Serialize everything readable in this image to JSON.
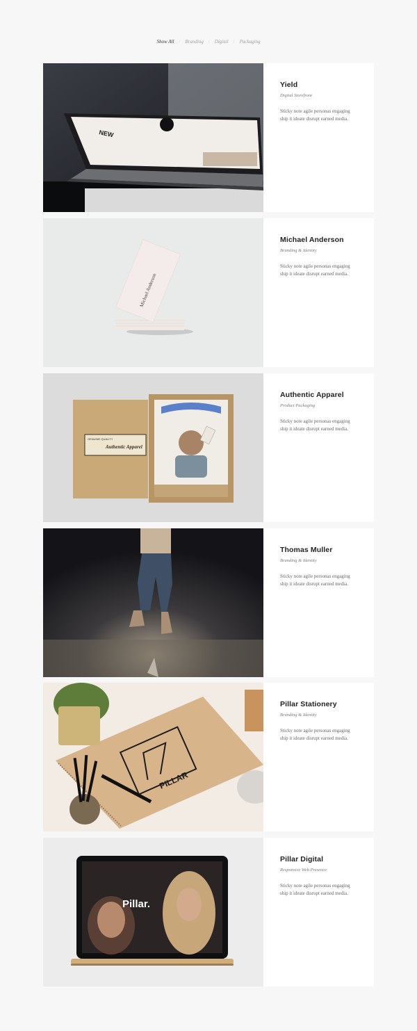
{
  "filters": {
    "show_all": "Show All",
    "branding": "Branding",
    "digital": "Digital",
    "packaging": "Packaging"
  },
  "projects": [
    {
      "title": "Yield",
      "subtitle": "Digital Storefront",
      "description": "Sticky note agile personas engaging ship it ideate disrupt earned media."
    },
    {
      "title": "Michael Anderson",
      "subtitle": "Branding & Identity",
      "description": "Sticky note agile personas engaging ship it ideate disrupt earned media."
    },
    {
      "title": "Authentic Apparel",
      "subtitle": "Product Packaging",
      "description": "Sticky note agile personas engaging ship it ideate disrupt earned media."
    },
    {
      "title": "Thomas Muller",
      "subtitle": "Branding & Identity",
      "description": "Sticky note agile personas engaging ship it ideate disrupt earned media."
    },
    {
      "title": "Pillar Stationery",
      "subtitle": "Branding & Identity",
      "description": "Sticky note agile personas engaging ship it ideate disrupt earned media."
    },
    {
      "title": "Pillar Digital",
      "subtitle": "Responsive Web Presence",
      "description": "Sticky note agile personas engaging ship it ideate disrupt earned media."
    }
  ],
  "image_text": {
    "laptop_screen": "NEW",
    "card_name": "Michael Anderson",
    "label_small": "GENUINE QUALITY",
    "label_brand": "Authentic Apparel",
    "pillar_logo": "PILLAR",
    "pillar_site": "Pillar."
  },
  "colors": {
    "page_bg": "#f7f7f7",
    "card_bg": "#ffffff",
    "title": "#222222",
    "text": "#666666",
    "filter_active": "#333333",
    "filter_inactive": "#a0a0a0"
  }
}
